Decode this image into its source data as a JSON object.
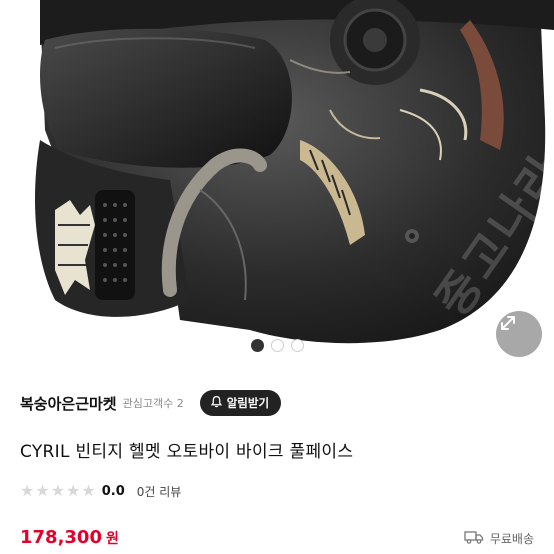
{
  "gallery": {
    "watermark": "중고나라",
    "dots_total": 3,
    "active_dot": 0
  },
  "seller": {
    "name": "복숭아은근마켓",
    "followers_label": "관심고객수 2",
    "notify_button": "알림받기"
  },
  "product": {
    "title": "CYRIL 빈티지 헬멧 오토바이 바이크 풀페이스",
    "rating": "0.0",
    "stars_total": 5,
    "review_count": "0건 리뷰",
    "price": "178,300",
    "currency": "원",
    "shipping": "무료배송"
  },
  "colors": {
    "price": "#e4002b",
    "button_bg": "#222222"
  },
  "icons": {
    "expand": "expand-arrows-icon",
    "bell": "bell-icon",
    "truck": "truck-icon",
    "star": "star-icon"
  }
}
